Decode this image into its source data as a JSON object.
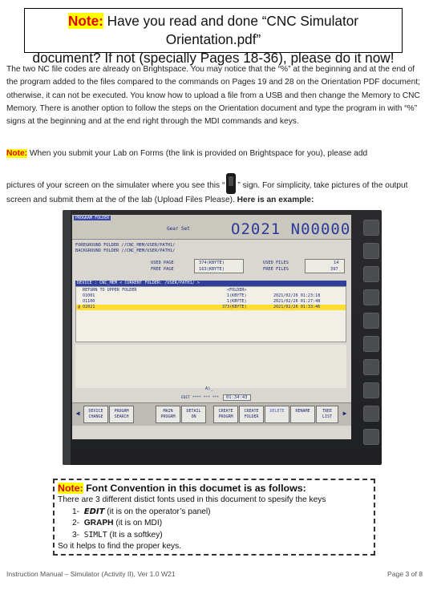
{
  "banner": {
    "note_label": "Note:",
    "line1_text": " Have you read and done “CNC Simulator Orientation.pdf”",
    "line2_text": "document? If not (specially Pages 18-36), please do it now!"
  },
  "intro_paragraph": "The two NC file codes are already on Brightspace. You may notice that the “%” at the beginning and at the end of the program added to the files compared to the commands on Pages 19 and 28 on the Orientation PDF document; otherwise, it can not be executed. You know how to upload a file from a USB and then change the Memory to CNC Memory. There is another option to follow the steps on the Orientation document and type the program in with “%” signs at the beginning and at the end right through the MDI commands and keys.",
  "note2": {
    "label": "Note:",
    "text_part1": " When you submit your Lab on Forms (the link is provided on Brightspace for you), please add",
    "text_part2a": "pictures of your screen on the simulater where you see this “",
    "text_part2b": "” sign. For simplicity, take pictures of the output screen and submit them at the of the lab (Upload Files Please). ",
    "example_bold": "Here is an example:"
  },
  "cnc_screen": {
    "title": "PROGRAM FOLDER",
    "mode": "Gear Set",
    "program_number": "O2021 N00000",
    "foreground_folder": "FOREGROUND FOLDER //CNC_MEM/USER/PATH1/",
    "background_folder": "BACKGROUND FOLDER //CNC_MEM/USER/PATH1/",
    "used_page_label": "USED PAGE",
    "used_page_value": "374(KBYTE)",
    "free_page_label": "FREE PAGE",
    "free_page_value": "163(KBYTE)",
    "used_files_label": "USED FILES",
    "used_files_value": "14",
    "free_files_label": "FREE FILES",
    "free_files_value": "397",
    "device_bar": "DEVICE : CNC_MEM    < CURRENT FOLDER: /USER/PATH1/ >",
    "files": [
      {
        "name": "RETURN TO UPPER FOLDER",
        "size": "<FOLDER>",
        "date": "",
        "selected": false
      },
      {
        "name": "O1001",
        "size": "1(KBYTE)",
        "date": "2021/02/26 01:23:18",
        "selected": false
      },
      {
        "name": "O1100",
        "size": "1(KBYTE)",
        "date": "2021/02/26 01:27:48",
        "selected": false
      },
      {
        "name": "@ O2021",
        "size": "373(KBYTE)",
        "date": "2021/02/26 01:33:46",
        "selected": true
      }
    ],
    "prompt": "A)_",
    "edit_status": "EDIT **** *** ***",
    "clock": "01:34:43",
    "softkeys": [
      {
        "line1": "DEVICE",
        "line2": "CHANGE"
      },
      {
        "line1": "PROGRM",
        "line2": "SEARCH"
      },
      {
        "line1": "MAIN",
        "line2": "PROGRM"
      },
      {
        "line1": "DETAIL",
        "line2": "ON"
      },
      {
        "line1": "CREATE",
        "line2": "PROGRM"
      },
      {
        "line1": "CREATE",
        "line2": "FOLDER"
      },
      {
        "line1": "DELETE",
        "line2": ""
      },
      {
        "line1": "RENAME",
        "line2": ""
      },
      {
        "line1": "TREE",
        "line2": "LIST"
      }
    ]
  },
  "font_convention": {
    "note_label": "Note:",
    "heading": " Font Convention in this documet is as follows:",
    "intro": "There are 3 different distict fonts used in this document to spesify the keys",
    "item1_num": "1-",
    "item1_key": "EDIT",
    "item1_desc": " (it is on the operator’s panel)",
    "item2_num": "2-",
    "item2_key": "GRAPH",
    "item2_desc": " (it is on MDI)",
    "item3_num": "3-",
    "item3_key": "SIMLT",
    "item3_desc": " (It is a softkey)",
    "closing": "So it helps to find the proper keys."
  },
  "footer": {
    "left": "Instruction Manual – Simulator (Activity II), Ver 1.0 W21",
    "right": "Page 3 of 8"
  }
}
